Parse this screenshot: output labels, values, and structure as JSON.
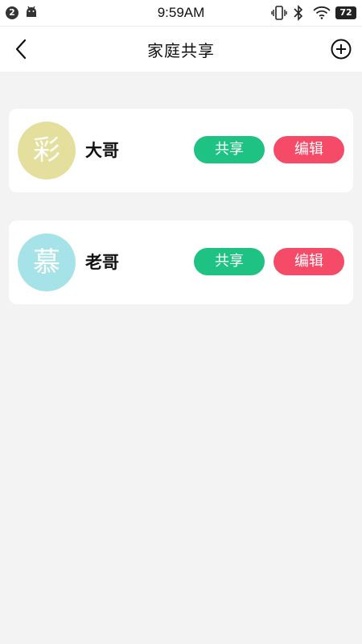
{
  "status_bar": {
    "notification_count": "2",
    "time": "9:59AM",
    "battery": "72",
    "icons": [
      "android-icon",
      "vibrate-icon",
      "bluetooth-icon",
      "wifi-icon",
      "battery-icon"
    ]
  },
  "nav": {
    "title": "家庭共享",
    "back_icon": "chevron-left",
    "add_icon": "circle-plus"
  },
  "members": [
    {
      "avatar_char": "彩",
      "avatar_color": "#e5df9d",
      "name": "大哥",
      "share_label": "共享",
      "edit_label": "编辑"
    },
    {
      "avatar_char": "慕",
      "avatar_color": "#a6e3e8",
      "name": "老哥",
      "share_label": "共享",
      "edit_label": "编辑"
    }
  ],
  "colors": {
    "share": "#1ec283",
    "edit": "#f64a69",
    "background": "#f4f3f4"
  }
}
